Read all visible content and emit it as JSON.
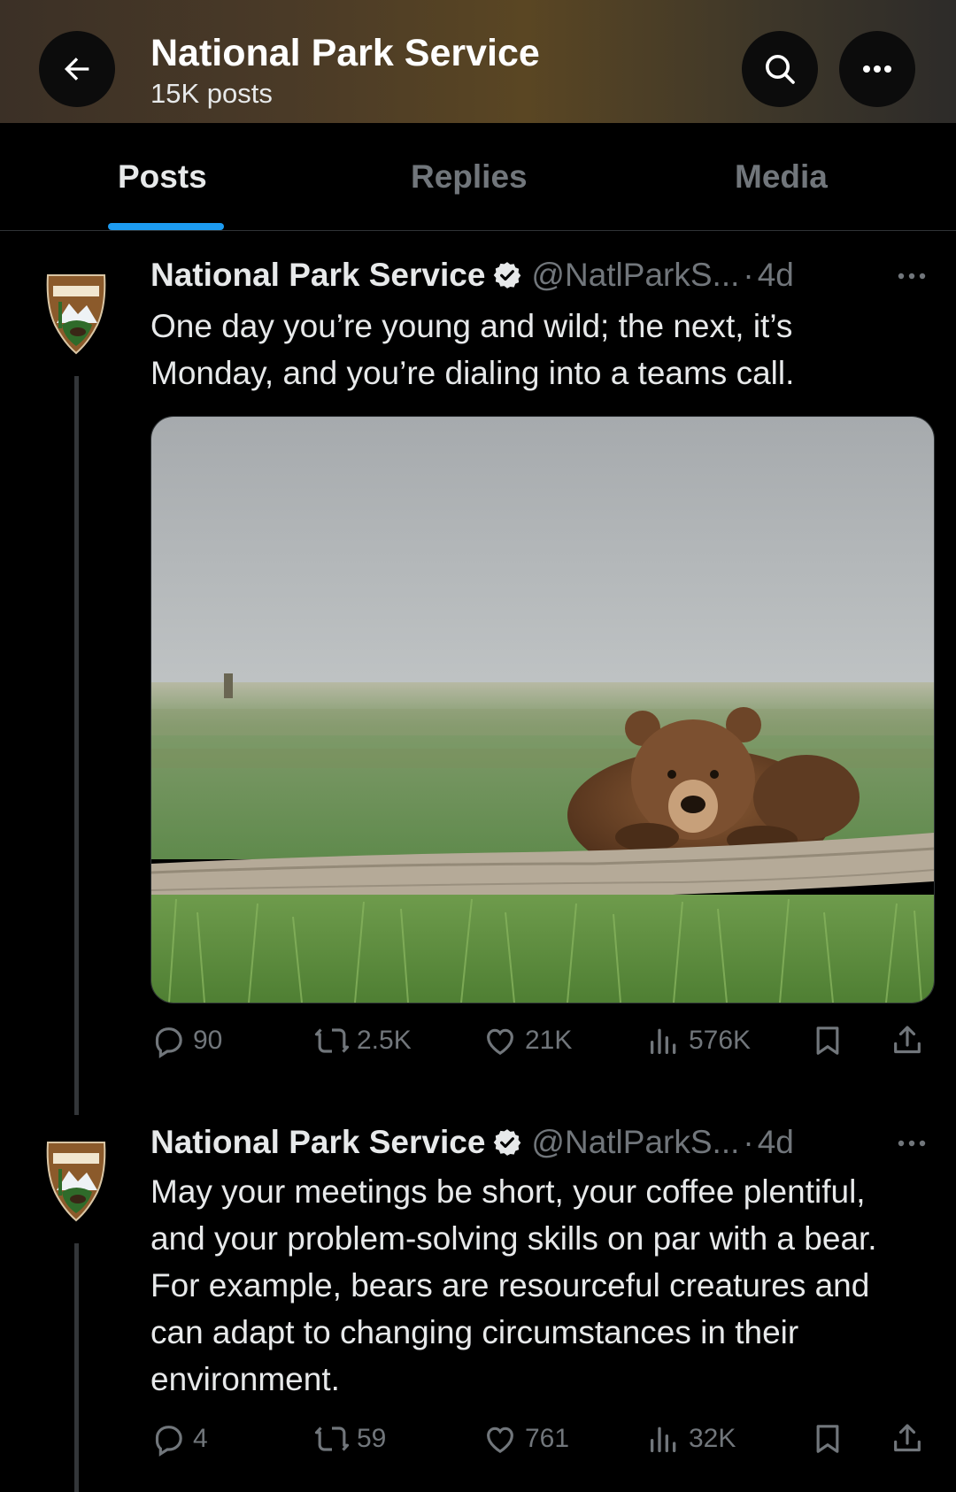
{
  "header": {
    "title": "National Park Service",
    "subtitle": "15K posts"
  },
  "tabs": [
    {
      "label": "Posts",
      "active": true
    },
    {
      "label": "Replies",
      "active": false
    },
    {
      "label": "Media",
      "active": false
    }
  ],
  "posts": [
    {
      "name": "National Park Service",
      "handle": "@NatlParkS...",
      "dot": "·",
      "time": "4d",
      "text": "One day you’re young and wild; the next, it’s Monday, and you’re dialing into a teams call.",
      "has_image": true,
      "replies": "90",
      "reposts": "2.5K",
      "likes": "21K",
      "views": "576K"
    },
    {
      "name": "National Park Service",
      "handle": "@NatlParkS...",
      "dot": "·",
      "time": "4d",
      "text": "May your meetings be short, your coffee plentiful, and your problem-solving skills on par with a bear. For example, bears are resourceful creatures and can adapt to changing circumstances in their environment.",
      "has_image": false,
      "replies": "4",
      "reposts": "59",
      "likes": "761",
      "views": "32K"
    }
  ],
  "colors": {
    "accent": "#1d9bf0",
    "muted": "#71767b",
    "text": "#e7e9ea",
    "background": "#000000"
  },
  "icons": [
    "back-arrow-icon",
    "search-icon",
    "more-icon",
    "verified-icon",
    "reply-icon",
    "repost-icon",
    "like-icon",
    "views-icon",
    "bookmark-icon",
    "share-icon"
  ]
}
